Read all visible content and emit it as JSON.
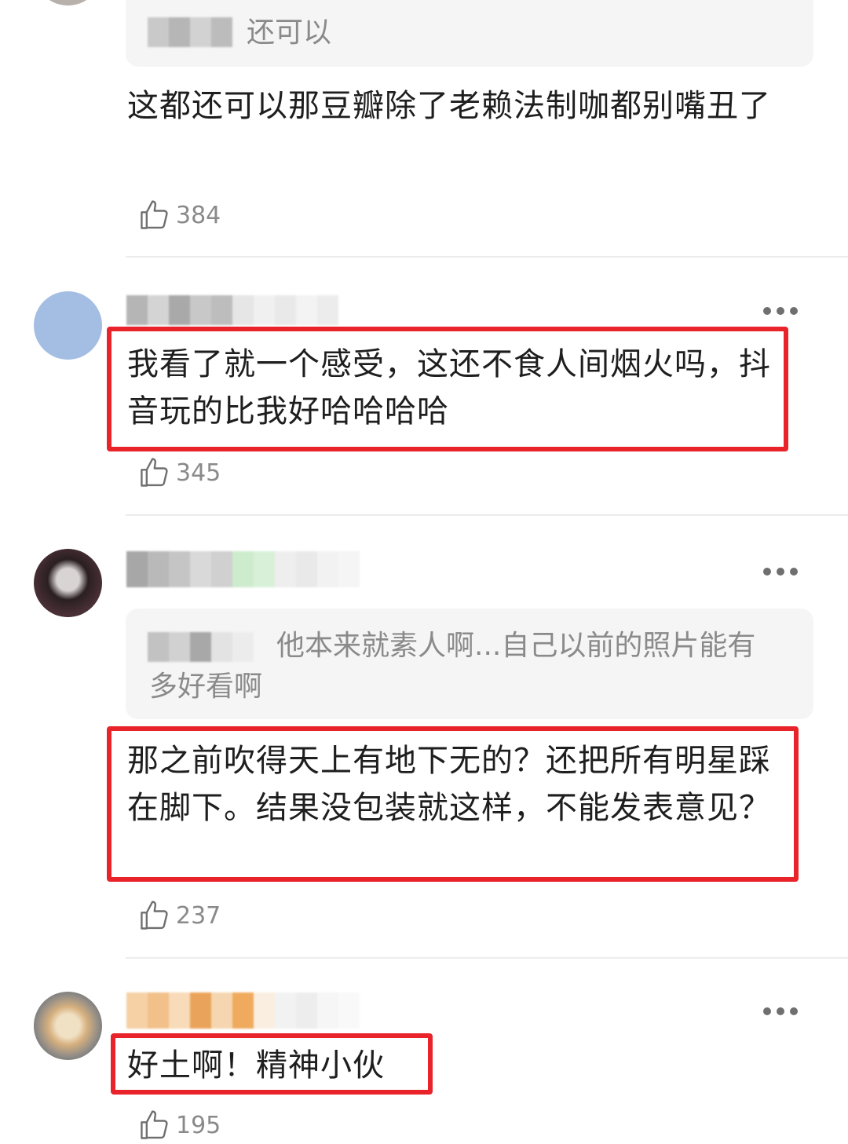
{
  "comments": [
    {
      "quote": {
        "text": "还可以"
      },
      "text": "这都还可以那豆瓣除了老赖法制咖都别嘴丑了",
      "likes": "384"
    },
    {
      "text": "我看了就一个感受，这还不食人间烟火吗，抖音玩的比我好哈哈哈哈",
      "likes": "345",
      "highlighted": true
    },
    {
      "quote": {
        "text": "他本来就素人啊...自己以前的照片能有多好看啊"
      },
      "text": "那之前吹得天上有地下无的？还把所有明星踩在脚下。结果没包装就这样，不能发表意见？",
      "likes": "237",
      "highlighted": true
    },
    {
      "text": "好土啊！精神小伙",
      "likes": "195",
      "highlighted": true
    }
  ],
  "icons": {
    "like": "thumbs-up-outline-icon",
    "more": "more-dots-icon"
  },
  "colors": {
    "highlight_border": "#e8232a",
    "quote_background": "#f5f5f5",
    "secondary_text": "#8a8a8a",
    "avatar_blue": "#a4bde3"
  }
}
